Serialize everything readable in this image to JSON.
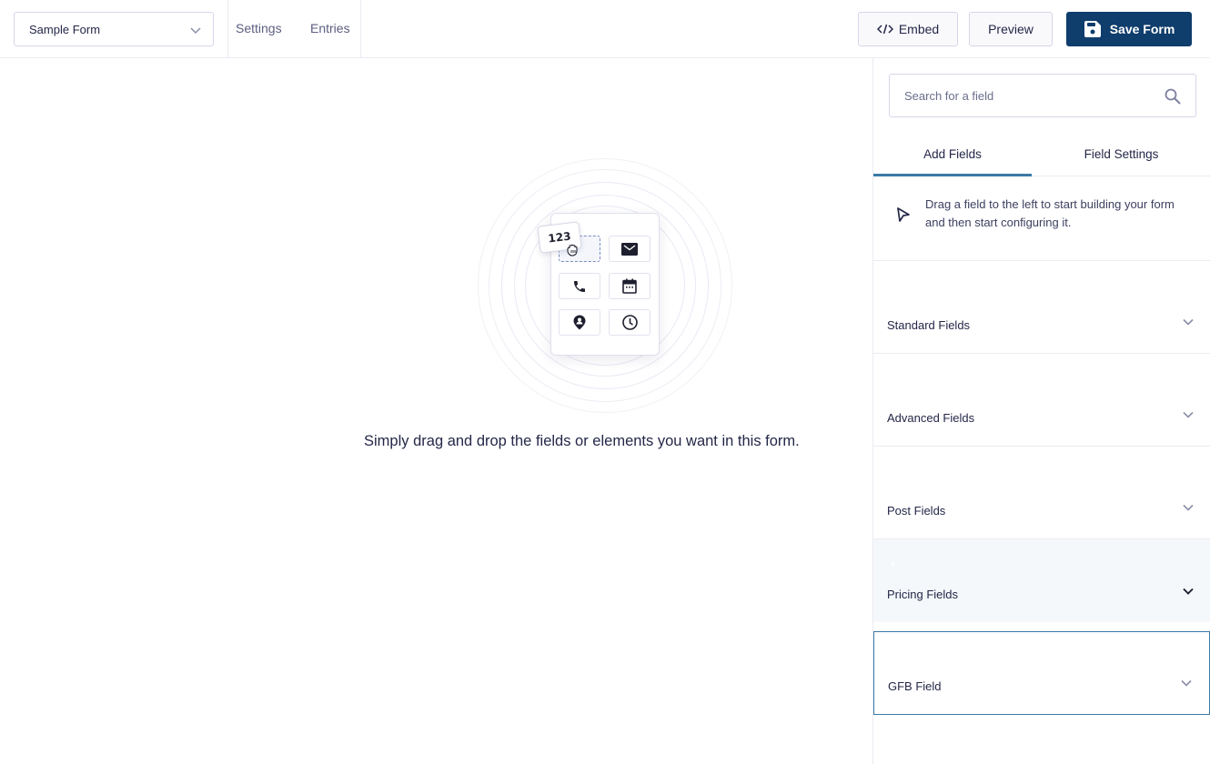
{
  "header": {
    "form_selector": {
      "value": "Sample Form",
      "icon": "chevron-down-icon"
    },
    "nav": [
      {
        "label": "Settings"
      },
      {
        "label": "Entries"
      }
    ],
    "buttons": {
      "embed": {
        "label": "Embed",
        "icon": "code-icon"
      },
      "preview": {
        "label": "Preview"
      },
      "save": {
        "label": "Save Form",
        "icon": "floppy-disk-icon"
      }
    }
  },
  "canvas": {
    "illustration": {
      "drag_chip_label": "123",
      "field_icons": [
        "number-placeholder",
        "envelope-icon",
        "phone-icon",
        "calendar-icon",
        "map-pin-icon",
        "clock-icon"
      ]
    },
    "empty_message": "Simply drag and drop the fields or elements you want in this form."
  },
  "sidebar": {
    "search": {
      "placeholder": "Search for a field",
      "value": ""
    },
    "tabs": [
      {
        "label": "Add Fields",
        "active": true
      },
      {
        "label": "Field Settings",
        "active": false
      }
    ],
    "hint": "Drag a field to the left to start building your form and then start configuring it.",
    "groups": [
      {
        "label": "Standard Fields",
        "state": "collapsed"
      },
      {
        "label": "Advanced Fields",
        "state": "collapsed"
      },
      {
        "label": "Post Fields",
        "state": "collapsed"
      },
      {
        "label": "Pricing Fields",
        "state": "hovered"
      },
      {
        "label": "GFB Field",
        "state": "focused"
      }
    ]
  },
  "colors": {
    "primary": "#0f3d6c",
    "tab_active": "#3b7aa6",
    "border": "#d5d7e9",
    "text": "#242748",
    "muted_text": "#5b5e80",
    "hover_bg": "#f5f8fb"
  }
}
